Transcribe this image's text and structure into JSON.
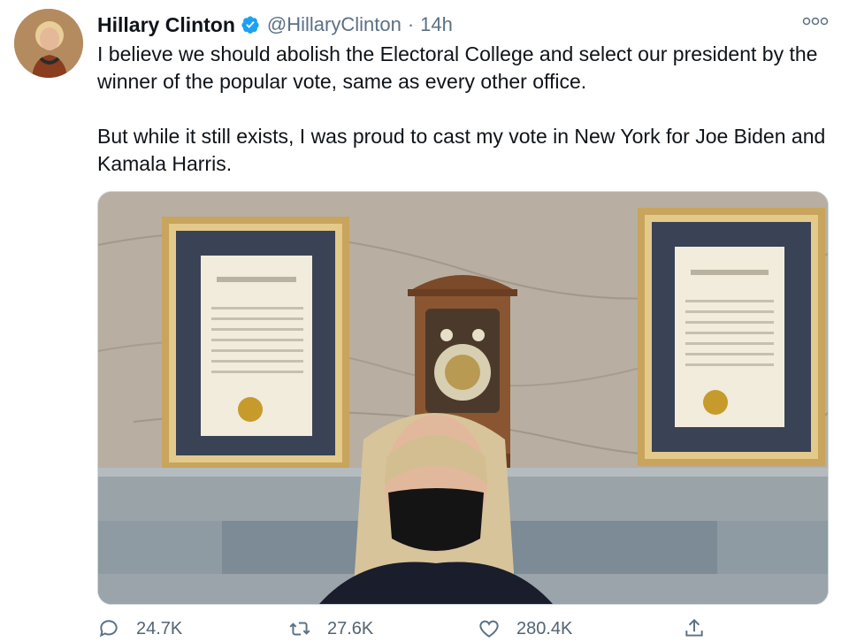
{
  "tweet": {
    "author_name": "Hillary Clinton",
    "handle": "@HillaryClinton",
    "separator": "·",
    "time": "14h",
    "paragraph1": "I believe we should abolish the Electoral College and select our president by the winner of the popular vote, same as every other office.",
    "paragraph2": "But while it still exists, I was proud to cast my vote in New York for Joe Biden and Kamala Harris."
  },
  "actions": {
    "reply_count": "24.7K",
    "retweet_count": "27.6K",
    "like_count": "280.4K"
  },
  "icons": {
    "verified": "verified-badge-icon",
    "more": "more-options-icon",
    "reply": "reply-icon",
    "retweet": "retweet-icon",
    "like": "like-icon",
    "share": "share-icon"
  },
  "colors": {
    "accent": "#1da1f2",
    "secondary_text": "#5b7083",
    "primary_text": "#0f1419"
  }
}
